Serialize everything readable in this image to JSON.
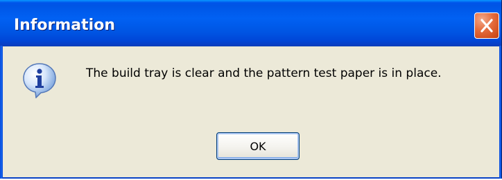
{
  "dialog": {
    "title": "Information",
    "message": "The build tray is clear and the pattern test paper is in place.",
    "icon": "information-icon",
    "ok_label": "OK",
    "close_icon": "close-icon"
  },
  "colors": {
    "titlebar_blue": "#0055ea",
    "close_red": "#e46b3c",
    "dialog_background": "#ece9d8",
    "ok_focus_border": "#7aa6ea"
  }
}
